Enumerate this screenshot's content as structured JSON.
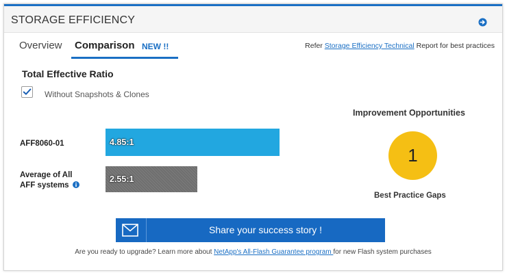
{
  "header": {
    "title": "STORAGE EFFICIENCY",
    "go_icon": "arrow-right-circle-icon"
  },
  "tabs": {
    "overview": "Overview",
    "comparison": "Comparison",
    "new_badge": "NEW !!",
    "refer_prefix": "Refer ",
    "refer_link": "Storage Efficiency Technical",
    "refer_suffix": " Report for best practices"
  },
  "ratio": {
    "title": "Total Effective Ratio",
    "checkbox_label": "Without Snapshots & Clones",
    "checkbox_checked": true
  },
  "chart_data": {
    "type": "bar",
    "orientation": "horizontal",
    "categories": [
      "AFF8060-01",
      "Average of All AFF systems"
    ],
    "values": [
      4.85,
      2.55
    ],
    "labels": [
      "4.85:1",
      "2.55:1"
    ],
    "colors": [
      "#22a7e0",
      "#6f6f6f"
    ],
    "xlim": [
      0,
      4.85
    ]
  },
  "rows": {
    "row1_label": "AFF8060-01",
    "row2_label_line1": "Average of All",
    "row2_label_line2": "AFF systems",
    "info_icon": "info-icon"
  },
  "improvement": {
    "title": "Improvement Opportunities",
    "count": "1",
    "label": "Best Practice Gaps",
    "color": "#f5bf14"
  },
  "share": {
    "label": "Share your success story !",
    "icon": "envelope-icon"
  },
  "footer": {
    "prefix": "Are you ready to upgrade? Learn more about ",
    "link": "NetApp's All-Flash Guarantee program ",
    "suffix": "for new Flash system purchases"
  }
}
